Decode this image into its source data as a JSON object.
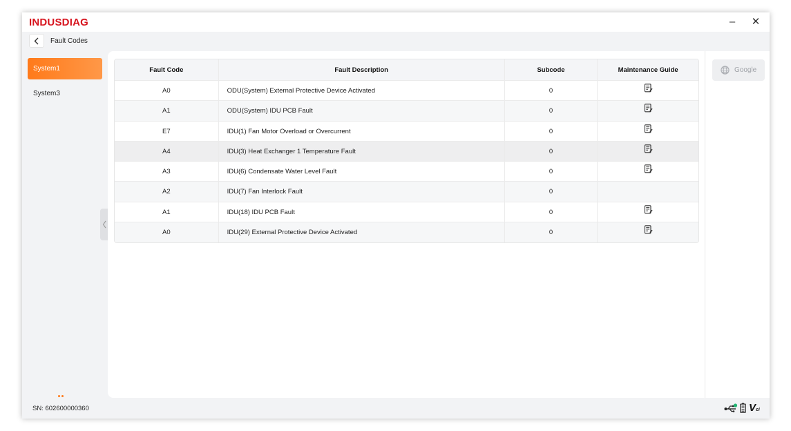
{
  "window": {
    "brand": "INDUSDIAG",
    "minimize": "–",
    "close": "✕"
  },
  "header": {
    "back_icon": "chevron-left-icon",
    "title": "Fault Codes"
  },
  "sidebar": {
    "items": [
      {
        "label": "System1",
        "active": true
      },
      {
        "label": "System3",
        "active": false
      }
    ]
  },
  "table": {
    "columns": [
      "Fault Code",
      "Fault Description",
      "Subcode",
      "Maintenance Guide"
    ],
    "rows": [
      {
        "code": "A0",
        "description": "ODU(System) External Protective Device Activated",
        "subcode": "0",
        "guide": true
      },
      {
        "code": "A1",
        "description": "ODU(System) IDU PCB Fault",
        "subcode": "0",
        "guide": true
      },
      {
        "code": "E7",
        "description": "IDU(1)  Fan Motor Overload or Overcurrent",
        "subcode": "0",
        "guide": true
      },
      {
        "code": "A4",
        "description": "IDU(3)  Heat Exchanger 1 Temperature Fault",
        "subcode": "0",
        "guide": true
      },
      {
        "code": "A3",
        "description": "IDU(6)  Condensate Water Level Fault",
        "subcode": "0",
        "guide": true
      },
      {
        "code": "A2",
        "description": "IDU(7)  Fan Interlock Fault",
        "subcode": "0",
        "guide": false
      },
      {
        "code": "A1",
        "description": "IDU(18)  IDU PCB Fault",
        "subcode": "0",
        "guide": true
      },
      {
        "code": "A0",
        "description": "IDU(29)  External Protective Device Activated",
        "subcode": "0",
        "guide": true
      }
    ]
  },
  "right_panel": {
    "google_label": "Google",
    "google_icon": "globe-icon"
  },
  "status_bar": {
    "serial": "SN: 602600000360",
    "icons": [
      "usb-icon",
      "battery-icon",
      "vci-icon"
    ],
    "vci_label": "V"
  },
  "colors": {
    "brand": "#d7141e",
    "accent": "#ff7a1a",
    "status_ok": "#22b573"
  }
}
